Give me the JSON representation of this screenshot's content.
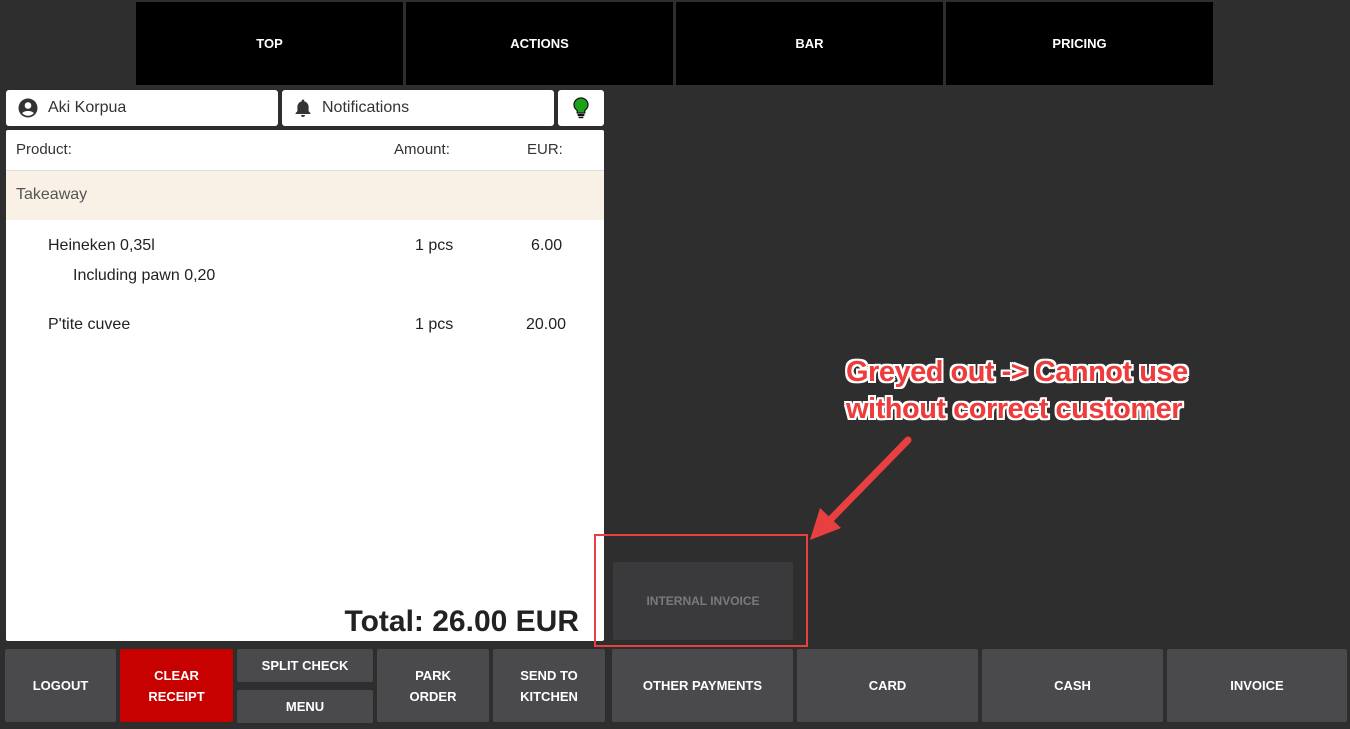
{
  "tabs": [
    "TOP",
    "ACTIONS",
    "BAR",
    "PRICING"
  ],
  "user": {
    "name": "Aki Korpua",
    "icon": "user-circle-icon"
  },
  "notifications": {
    "label": "Notifications",
    "icon": "bell-icon"
  },
  "status_light": {
    "icon": "lightbulb-icon",
    "color": "#1aa31a"
  },
  "receipt": {
    "headers": {
      "product": "Product:",
      "amount": "Amount:",
      "currency": "EUR:"
    },
    "group": "Takeaway",
    "items": [
      {
        "name": "Heineken 0,35l",
        "amount": "1 pcs",
        "price": "6.00",
        "note": "Including pawn 0,20"
      },
      {
        "name": "P'tite cuvee",
        "amount": "1 pcs",
        "price": "20.00"
      }
    ],
    "total": "Total: 26.00 EUR"
  },
  "internal_invoice": {
    "label": "INTERNAL INVOICE",
    "state": "disabled"
  },
  "bottom": {
    "logout": "LOGOUT",
    "clear_receipt": [
      "CLEAR",
      "RECEIPT"
    ],
    "split_check": "SPLIT CHECK",
    "menu": "MENU",
    "park_order": [
      "PARK",
      "ORDER"
    ],
    "send_to_kitchen": [
      "SEND TO",
      "KITCHEN"
    ],
    "other_payments": "OTHER PAYMENTS",
    "card": "CARD",
    "cash": "CASH",
    "invoice": "INVOICE"
  },
  "annotation": {
    "lines": [
      "Greyed out -> Cannot use",
      "without correct customer"
    ],
    "color": "#ee3b3b"
  },
  "colors": {
    "accent_red": "#c70000",
    "button": "#4a4a4c",
    "background": "#2e2e2f"
  }
}
